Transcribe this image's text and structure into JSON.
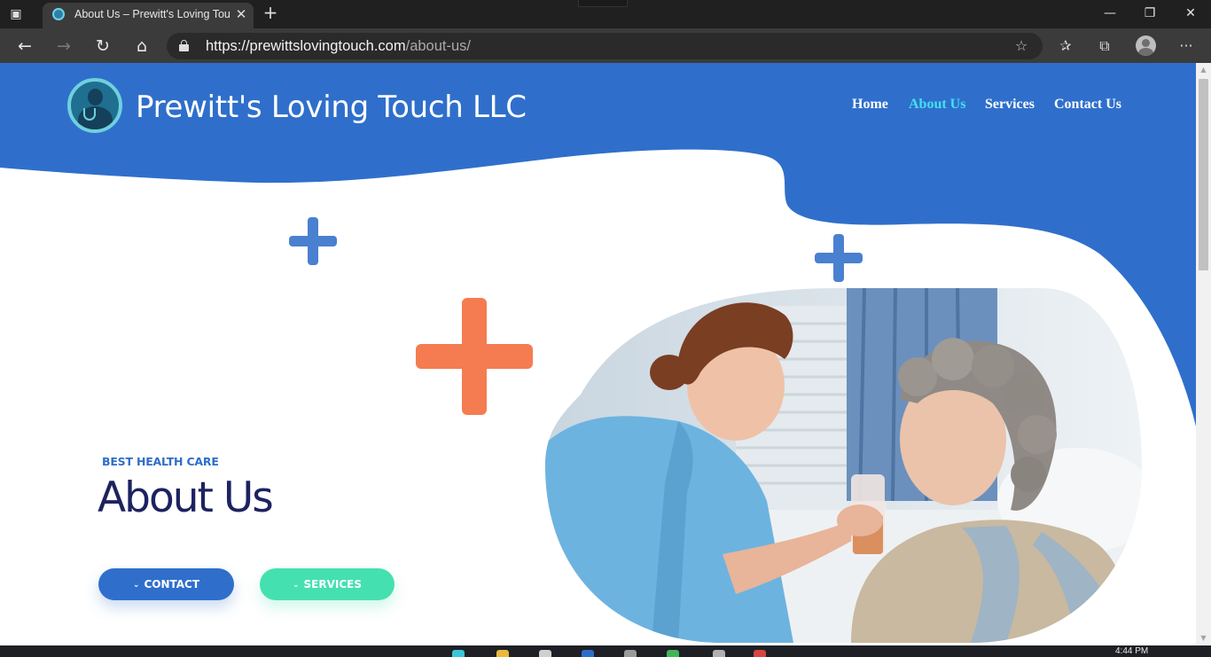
{
  "browser": {
    "tab": {
      "title": "About Us – Prewitt's Loving Touch LLC",
      "close_glyph": "✕"
    },
    "new_tab_glyph": "+",
    "window_controls": {
      "minimize": "—",
      "restore": "❐",
      "close": "✕"
    },
    "nav": {
      "back": "←",
      "forward": "→",
      "refresh": "↻",
      "home": "⌂"
    },
    "address": {
      "host": "https://prewittslovingtouch.com",
      "path": "/about-us/"
    },
    "toolbar_icons": [
      "add-favorite-icon",
      "favorites-icon",
      "collections-icon",
      "profile-icon",
      "more-icon"
    ],
    "more_glyph": "···"
  },
  "site": {
    "name": "Prewitt's Loving Touch LLC",
    "nav": [
      {
        "label": "Home",
        "active": false
      },
      {
        "label": "About Us",
        "active": true
      },
      {
        "label": "Services",
        "active": false
      },
      {
        "label": "Contact Us",
        "active": false
      }
    ]
  },
  "hero": {
    "subheading": "BEST HEALTH CARE",
    "title": "About Us",
    "buttons": {
      "contact": "CONTACT",
      "services": "SERVICES"
    },
    "chevron_glyph": "⌄"
  },
  "taskbar": {
    "time": "4:44 PM"
  },
  "colors": {
    "brand_blue": "#2f6fcb",
    "nav_active": "#45e0f0",
    "accent_orange": "#f57c50",
    "accent_teal": "#45e0b0",
    "title_navy": "#1d2360"
  }
}
